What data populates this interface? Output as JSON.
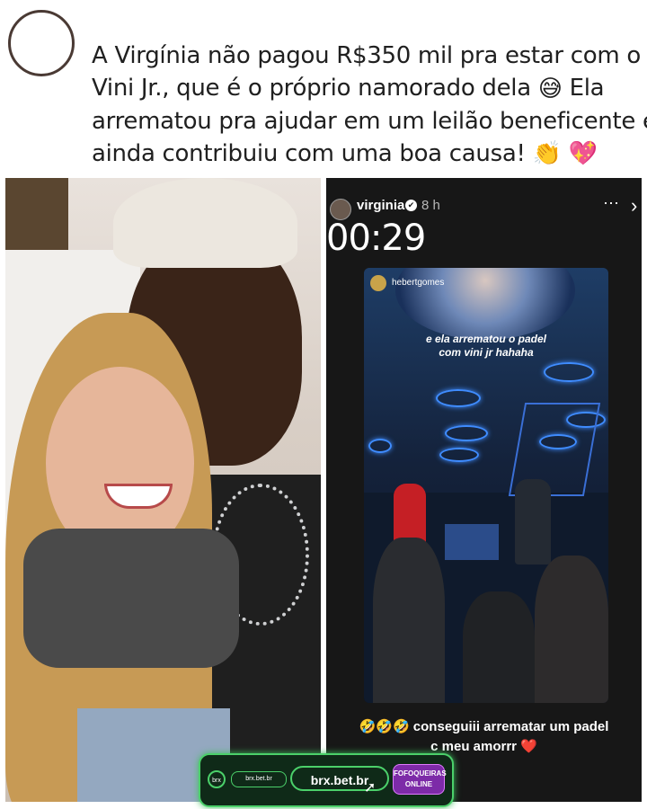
{
  "tweet": {
    "lines": [
      "A Virgínia não pagou R$350 mil pra estar com o",
      "Vini Jr., que é o próprio namorado dela",
      "arrematou pra ajudar em um leilão beneficente e",
      "ainda contribuiu com uma boa causa!"
    ],
    "line2_tail": "Ela",
    "emoji_sweat": "😅",
    "emoji_clap": "👏",
    "emoji_heart": "💖"
  },
  "story": {
    "username": "virginia",
    "verified_icon": "✔",
    "time": "8 h",
    "more_icon": "⋯",
    "close_icon": "›",
    "timer": "00:29",
    "repost": {
      "username": "hebertgomes",
      "caption_lines": [
        "e ela arrematou o padel",
        "com vini jr hahaha"
      ]
    },
    "bottom_text_lines": [
      "🤣🤣🤣 conseguiii arrematar um padel",
      "c meu amorrr ❤️"
    ]
  },
  "banner": {
    "logo": "brx",
    "pill": "brx.bet.br",
    "url": "brx.bet.br",
    "cursor_icon": "➚",
    "badge_lines": [
      "FOFOQUEIRAS",
      "ONLINE"
    ]
  }
}
